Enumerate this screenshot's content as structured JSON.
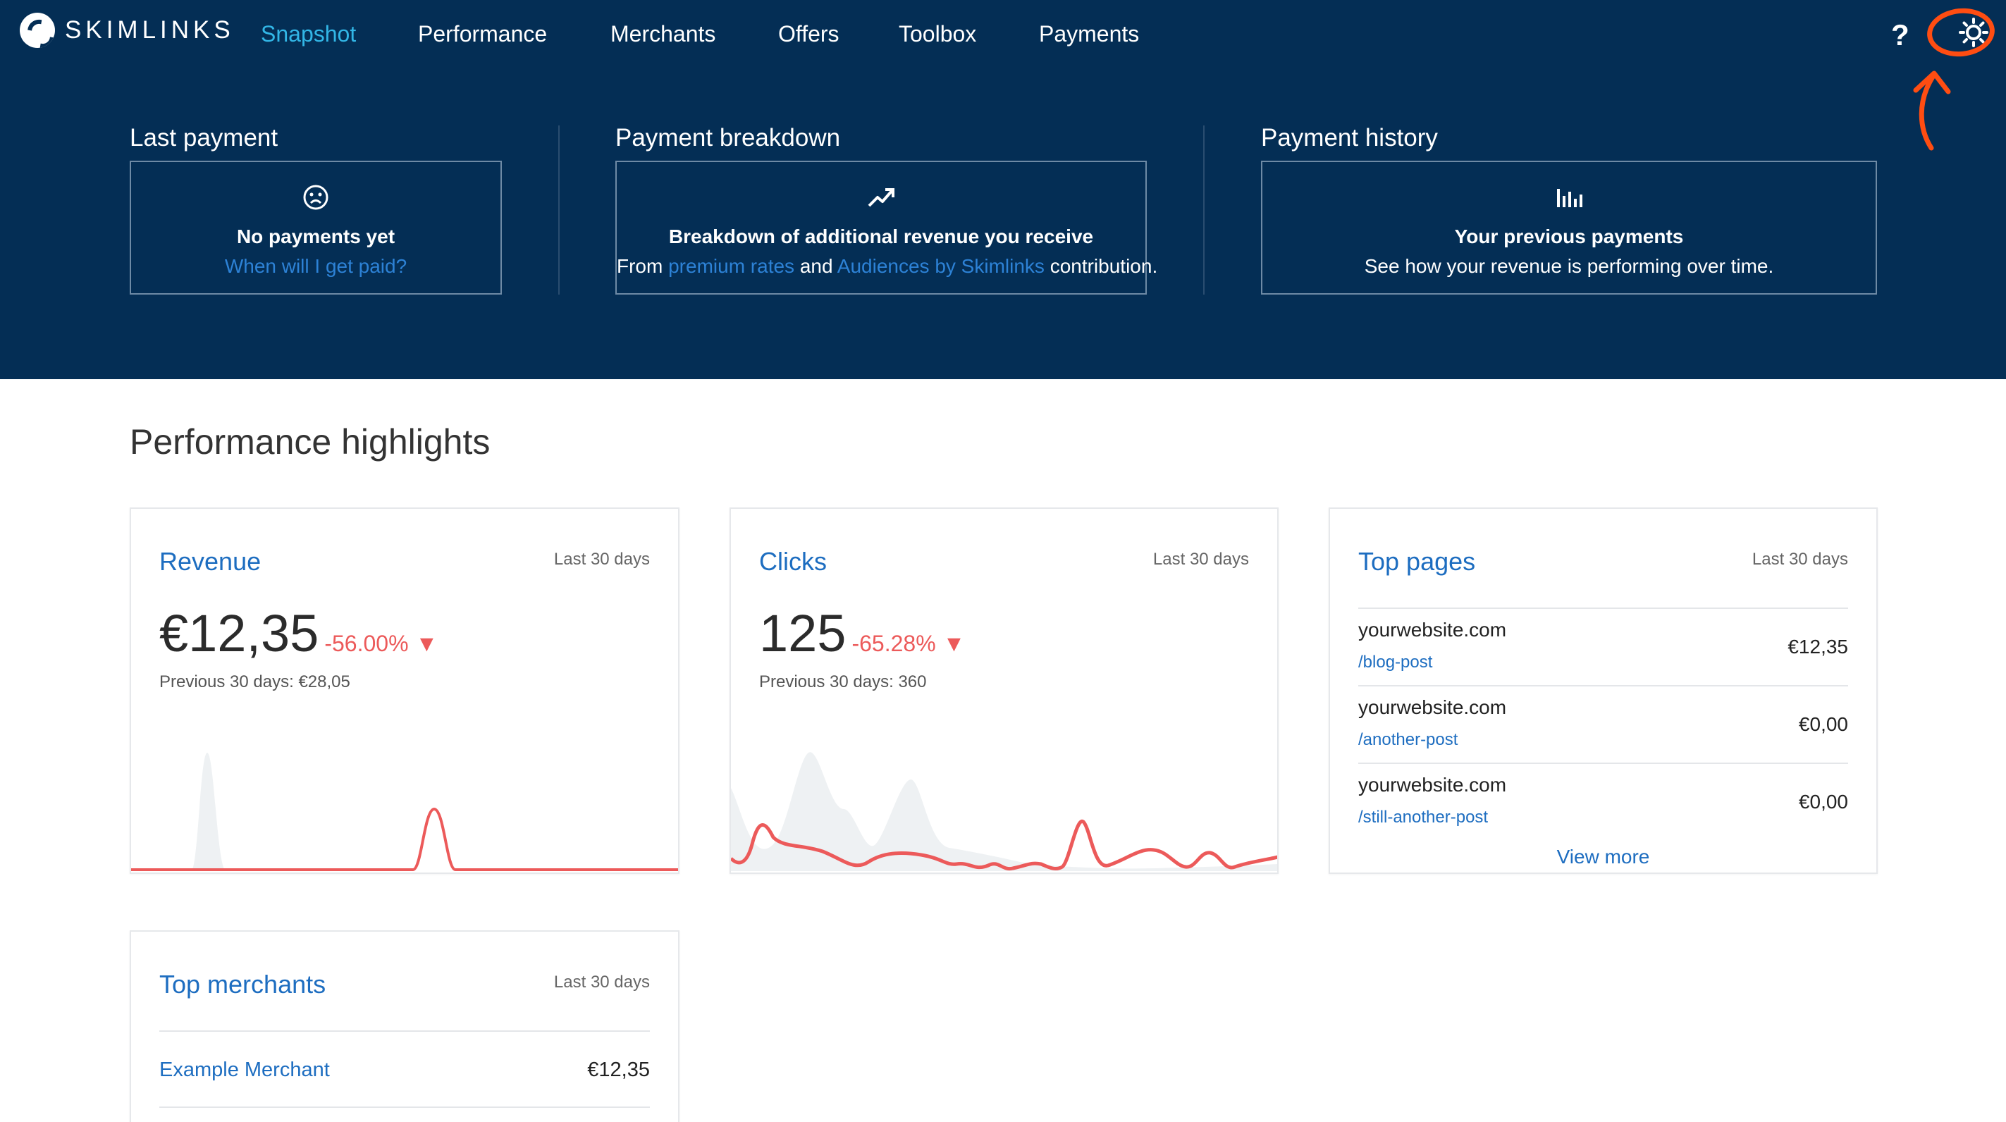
{
  "brand": {
    "name": "SKIMLINKS"
  },
  "nav": {
    "items": [
      {
        "label": "Snapshot",
        "active": true
      },
      {
        "label": "Performance"
      },
      {
        "label": "Merchants"
      },
      {
        "label": "Offers"
      },
      {
        "label": "Toolbox"
      },
      {
        "label": "Payments"
      }
    ],
    "help_label": "?",
    "settings_icon": "gear-icon"
  },
  "colors": {
    "header_bg": "#042e55",
    "active_nav": "#32b6e6",
    "link": "#1d6dc0",
    "negative": "#ec5a5a",
    "annotation": "#ff4d12"
  },
  "payments": {
    "last": {
      "title": "Last payment",
      "icon": "sad-face-icon",
      "headline": "No payments yet",
      "link": "When will I get paid?"
    },
    "breakdown": {
      "title": "Payment breakdown",
      "icon": "trending-up-icon",
      "headline": "Breakdown of additional revenue you receive",
      "text_from": "From",
      "link1": "premium rates",
      "text_and": "and",
      "link2": "Audiences by Skimlinks",
      "text_end": "contribution."
    },
    "history": {
      "title": "Payment history",
      "icon": "bar-chart-icon",
      "headline": "Your previous payments",
      "text": "See how your revenue is performing over time."
    }
  },
  "highlights": {
    "title": "Performance highlights",
    "revenue": {
      "title": "Revenue",
      "period": "Last 30 days",
      "value": "€12,35",
      "change": "-56.00%",
      "arrow": "▼",
      "previous": "Previous 30 days: €28,05"
    },
    "clicks": {
      "title": "Clicks",
      "period": "Last 30 days",
      "value": "125",
      "change": "-65.28%",
      "arrow": "▼",
      "previous": "Previous 30 days: 360"
    },
    "top_pages": {
      "title": "Top pages",
      "period": "Last 30 days",
      "rows": [
        {
          "site": "yourwebsite.com",
          "path": "/blog-post",
          "amount": "€12,35"
        },
        {
          "site": "yourwebsite.com",
          "path": "/another-post",
          "amount": "€0,00"
        },
        {
          "site": "yourwebsite.com",
          "path": "/still-another-post",
          "amount": "€0,00"
        }
      ],
      "view_more": "View more"
    },
    "top_merchants": {
      "title": "Top merchants",
      "period": "Last 30 days",
      "rows": [
        {
          "name": "Example Merchant",
          "amount": "€12,35"
        }
      ]
    }
  }
}
